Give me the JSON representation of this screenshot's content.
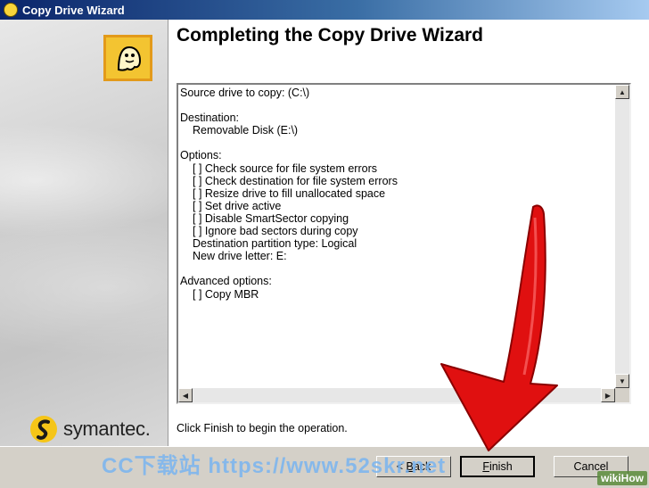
{
  "window": {
    "title": "Copy Drive Wizard"
  },
  "sidebar": {
    "brand": "symantec."
  },
  "main": {
    "heading": "Completing the Copy Drive Wizard",
    "summary_lines": [
      "Source drive to copy: (C:\\)",
      "",
      "Destination:",
      "    Removable Disk (E:\\)",
      "",
      "Options:",
      "    [ ] Check source for file system errors",
      "    [ ] Check destination for file system errors",
      "    [ ] Resize drive to fill unallocated space",
      "    [ ] Set drive active",
      "    [ ] Disable SmartSector copying",
      "    [ ] Ignore bad sectors during copy",
      "    Destination partition type: Logical",
      "    New drive letter: E:",
      "",
      "Advanced options:",
      "    [ ] Copy MBR"
    ],
    "instruction": "Click Finish to begin the operation."
  },
  "buttons": {
    "back_arrow": "< ",
    "back_key": "B",
    "back_rest": "ack",
    "finish_key": "F",
    "finish_rest": "inish",
    "cancel": "Cancel"
  },
  "overlays": {
    "watermark": "CC下载站 https://www.52skr.net",
    "wikihow": "wikiHow"
  },
  "icons": {
    "title_icon": "norton-ghost-icon",
    "logo": "ghost-icon",
    "brand_mark": "symantec-logo-icon",
    "arrow": "red-arrow-annotation"
  },
  "colors": {
    "accent_yellow": "#f3c431",
    "arrow_red": "#e01010"
  }
}
